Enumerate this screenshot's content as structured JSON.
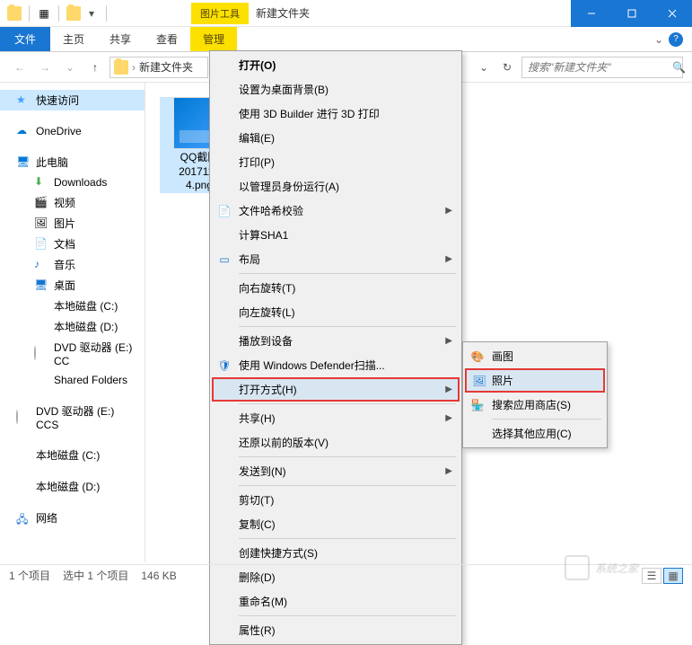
{
  "titlebar": {
    "tools_label": "图片工具",
    "window_title": "新建文件夹"
  },
  "ribbon": {
    "file": "文件",
    "home": "主页",
    "share": "共享",
    "view": "查看",
    "manage": "管理"
  },
  "address": {
    "folder_name": "新建文件夹",
    "search_placeholder": "搜索\"新建文件夹\""
  },
  "sidebar": {
    "quick_access": "快速访问",
    "onedrive": "OneDrive",
    "this_pc": "此电脑",
    "downloads": "Downloads",
    "videos": "视频",
    "pictures": "图片",
    "documents": "文档",
    "music": "音乐",
    "desktop": "桌面",
    "drive_c": "本地磁盘 (C:)",
    "drive_d": "本地磁盘 (D:)",
    "dvd_e": "DVD 驱动器 (E:) CC",
    "shared_folders": "Shared Folders",
    "dvd_e2": "DVD 驱动器 (E:) CCS",
    "drive_c2": "本地磁盘 (C:)",
    "drive_d2": "本地磁盘 (D:)",
    "network": "网络"
  },
  "file": {
    "name_line1": "QQ截图",
    "name_line2": "2017112",
    "name_line3": "4.png"
  },
  "context_menu": {
    "open": "打开(O)",
    "set_wallpaper": "设置为桌面背景(B)",
    "3d_builder": "使用 3D Builder 进行 3D 打印",
    "edit": "编辑(E)",
    "print": "打印(P)",
    "run_as_admin": "以管理员身份运行(A)",
    "file_hash": "文件哈希校验",
    "calc_sha1": "计算SHA1",
    "layout": "布局",
    "rotate_right": "向右旋转(T)",
    "rotate_left": "向左旋转(L)",
    "cast_to_device": "播放到设备",
    "defender_scan": "使用 Windows Defender扫描...",
    "open_with": "打开方式(H)",
    "share": "共享(H)",
    "restore_previous": "还原以前的版本(V)",
    "send_to": "发送到(N)",
    "cut": "剪切(T)",
    "copy": "复制(C)",
    "create_shortcut": "创建快捷方式(S)",
    "delete": "删除(D)",
    "rename": "重命名(M)",
    "properties": "属性(R)"
  },
  "submenu": {
    "paint": "画图",
    "photos": "照片",
    "search_store": "搜索应用商店(S)",
    "choose_other": "选择其他应用(C)"
  },
  "statusbar": {
    "item_count": "1 个项目",
    "selection": "选中 1 个项目",
    "size": "146 KB"
  },
  "watermark": "系统之家"
}
